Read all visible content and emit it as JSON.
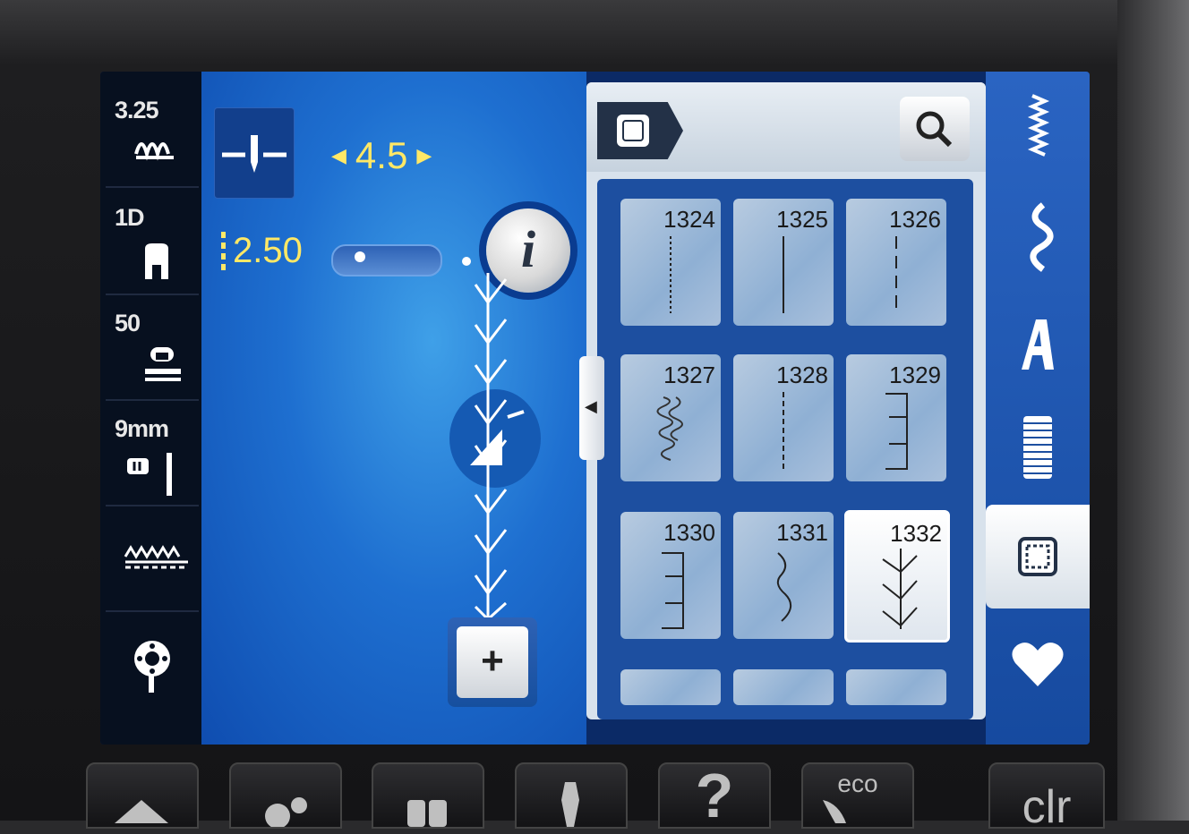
{
  "left_sidebar": {
    "items": [
      {
        "value": "3.25",
        "icon": "thread-tension-icon"
      },
      {
        "value": "1D",
        "icon": "presser-foot-icon"
      },
      {
        "value": "50",
        "icon": "foot-pressure-icon"
      },
      {
        "value": "9mm",
        "icon": "needle-plate-icon"
      },
      {
        "value": "",
        "icon": "feed-dog-icon"
      },
      {
        "value": "",
        "icon": "bobbin-icon"
      }
    ]
  },
  "stitch_controls": {
    "width_value": "4.5",
    "length_value": "2.50",
    "info_label": "i"
  },
  "pattern_panel": {
    "tiles": [
      {
        "number": "1324"
      },
      {
        "number": "1325"
      },
      {
        "number": "1326"
      },
      {
        "number": "1327"
      },
      {
        "number": "1328"
      },
      {
        "number": "1329"
      },
      {
        "number": "1330"
      },
      {
        "number": "1331"
      },
      {
        "number": "1332",
        "selected": true
      }
    ]
  },
  "right_bar": {
    "items": [
      "practical-stitches-icon",
      "decorative-stitches-icon",
      "alphabets-icon",
      "buttonholes-icon",
      "quilt-stitches-icon",
      "personal-program-icon"
    ],
    "active_index": 4
  },
  "hardware_buttons": {
    "eco_label": "eco",
    "help_label": "?",
    "clr_label": "clr"
  },
  "colors": {
    "accent_yellow": "#ffe866",
    "panel_blue": "#1d4fa0",
    "main_blue": "#1e6fd0"
  }
}
